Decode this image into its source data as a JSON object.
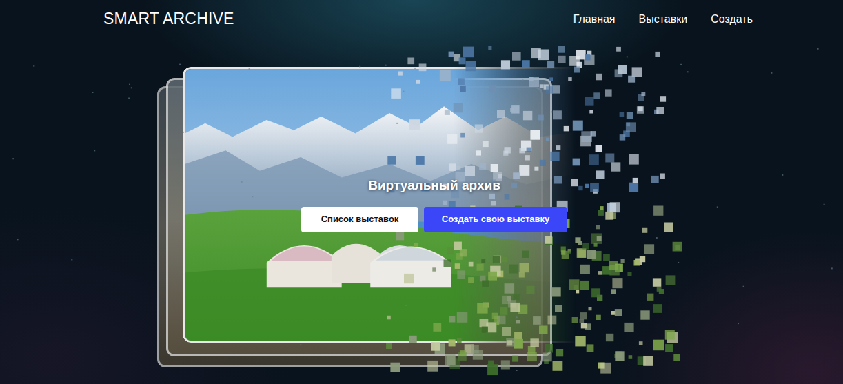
{
  "brand": {
    "title": "SMART ARCHIVE"
  },
  "nav": [
    {
      "label": "Главная"
    },
    {
      "label": "Выставки"
    },
    {
      "label": "Создать"
    }
  ],
  "hero": {
    "title": "Виртуальный архив",
    "buttons": [
      {
        "label": "Список выставок",
        "kind": "light"
      },
      {
        "label": "Создать свою выставку",
        "kind": "primary"
      }
    ]
  }
}
